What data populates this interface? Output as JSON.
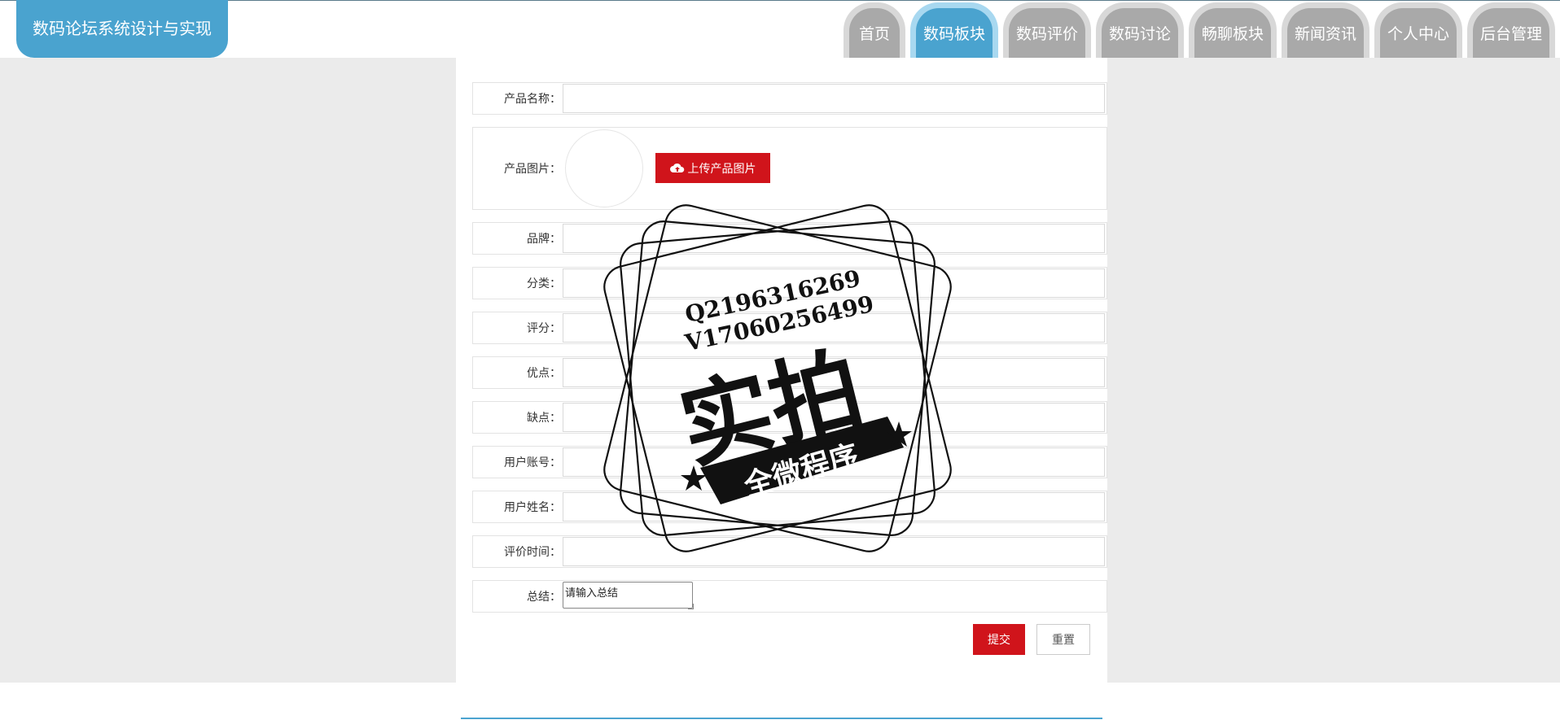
{
  "app": {
    "title": "数码论坛系统设计与实现"
  },
  "nav": {
    "items": [
      {
        "label": "首页"
      },
      {
        "label": "数码板块"
      },
      {
        "label": "数码评价"
      },
      {
        "label": "数码讨论"
      },
      {
        "label": "畅聊板块"
      },
      {
        "label": "新闻资讯"
      },
      {
        "label": "个人中心"
      },
      {
        "label": "后台管理"
      }
    ],
    "active": "数码板块"
  },
  "form": {
    "product_name": {
      "label": "产品名称：",
      "value": ""
    },
    "product_image": {
      "label": "产品图片：",
      "upload_label": "上传产品图片",
      "upload_icon": "cloud-upload-icon"
    },
    "brand": {
      "label": "品牌：",
      "value": ""
    },
    "category": {
      "label": "分类：",
      "value": ""
    },
    "rating": {
      "label": "评分：",
      "value": ""
    },
    "pros": {
      "label": "优点：",
      "value": ""
    },
    "cons": {
      "label": "缺点：",
      "value": ""
    },
    "user_account": {
      "label": "用户账号：",
      "value": ""
    },
    "user_name": {
      "label": "用户姓名：",
      "value": ""
    },
    "review_time": {
      "label": "评价时间：",
      "value": ""
    },
    "summary": {
      "label": "总结：",
      "placeholder": "请输入总结"
    },
    "submit_label": "提交",
    "reset_label": "重置"
  },
  "watermark": {
    "qq": "Q2196316269",
    "vx": "V17060256499",
    "main": "实拍",
    "banner": "全微程序"
  },
  "colors": {
    "accent": "#4aa3cf",
    "button_red": "#d0141b",
    "nav_inactive": "#a9a9a9",
    "page_bg": "#ebebeb"
  }
}
